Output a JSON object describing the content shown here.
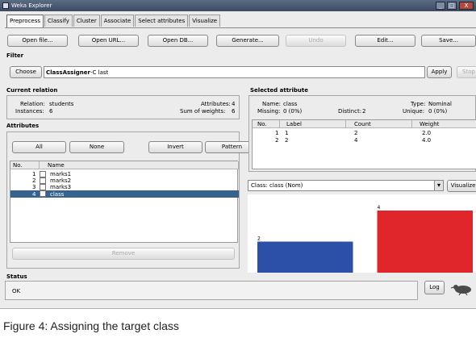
{
  "window": {
    "title": "Weka Explorer",
    "minimize": "_",
    "maximize": "□",
    "close": "X"
  },
  "tabs": [
    "Preprocess",
    "Classify",
    "Cluster",
    "Associate",
    "Select attributes",
    "Visualize"
  ],
  "toolbar": {
    "open_file": "Open file...",
    "open_url": "Open URL...",
    "open_db": "Open DB...",
    "generate": "Generate...",
    "undo": "Undo",
    "edit": "Edit...",
    "save": "Save..."
  },
  "filter": {
    "section": "Filter",
    "choose": "Choose",
    "value_name": "ClassAssigner",
    "value_args": " -C last",
    "apply": "Apply",
    "stop": "Stop"
  },
  "current_relation": {
    "section": "Current relation",
    "relation_label": "Relation:",
    "relation": "students",
    "instances_label": "Instances:",
    "instances": "6",
    "attributes_label": "Attributes:",
    "attributes": "4",
    "weights_label": "Sum of weights:",
    "weights": "6"
  },
  "attributes": {
    "section": "Attributes",
    "all": "All",
    "none": "None",
    "invert": "Invert",
    "pattern": "Pattern",
    "col_no": "No.",
    "col_name": "Name",
    "rows": [
      {
        "no": "1",
        "name": "marks1"
      },
      {
        "no": "2",
        "name": "marks2"
      },
      {
        "no": "3",
        "name": "marks3"
      },
      {
        "no": "4",
        "name": "class"
      }
    ],
    "remove": "Remove"
  },
  "selected_attribute": {
    "section": "Selected attribute",
    "name_label": "Name:",
    "name": "class",
    "type_label": "Type:",
    "type": "Nominal",
    "missing_label": "Missing:",
    "missing": "0 (0%)",
    "distinct_label": "Distinct:",
    "distinct": "2",
    "unique_label": "Unique:",
    "unique": "0 (0%)",
    "columns": [
      "No.",
      "Label",
      "Count",
      "Weight"
    ],
    "rows": [
      {
        "no": "1",
        "label": "1",
        "count": "2",
        "weight": "2.0"
      },
      {
        "no": "2",
        "label": "2",
        "count": "4",
        "weight": "4.0"
      }
    ]
  },
  "visualize": {
    "class_select": "Class: class (Nom)",
    "dropdown_arrow": "▾",
    "button": "Visualize"
  },
  "chart_data": {
    "type": "bar",
    "values": [
      2,
      4
    ],
    "data_labels": [
      "2",
      "4"
    ],
    "colors": [
      "#2c4fa8",
      "#e0262a"
    ]
  },
  "status": {
    "section": "Status",
    "text": "OK",
    "log": "Log"
  },
  "caption": "Figure 4: Assigning the target class"
}
